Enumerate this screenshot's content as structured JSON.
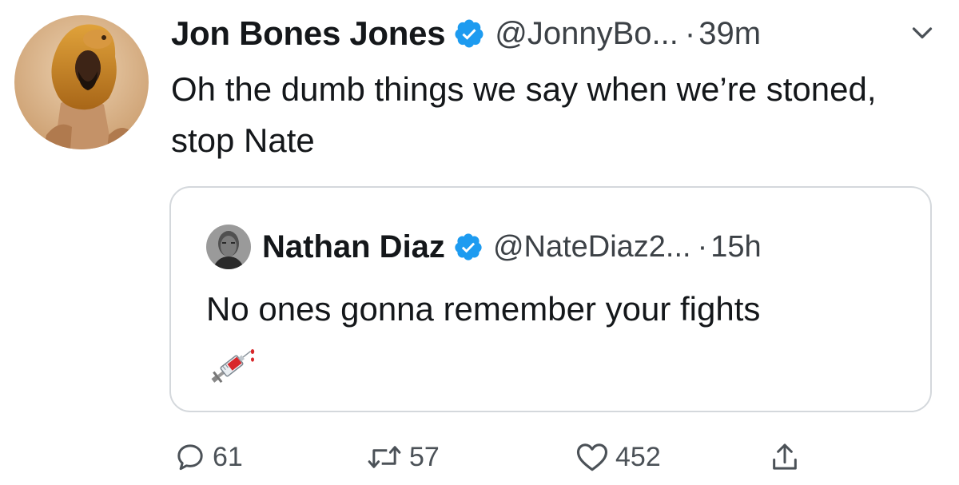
{
  "tweet": {
    "author": {
      "display_name": "Jon Bones Jones",
      "handle": "@JonnyBo...",
      "avatar_icon": "avatar-lion-headdress",
      "verified_icon": "verified-badge-icon"
    },
    "separator": "·",
    "timestamp": "39m",
    "menu_icon": "chevron-down-icon",
    "text": "Oh the dumb things we say when we’re stoned, stop Nate"
  },
  "quoted_tweet": {
    "author": {
      "display_name": "Nathan Diaz",
      "handle": "@NateDiaz2...",
      "avatar_icon": "avatar-portrait",
      "verified_icon": "verified-badge-icon"
    },
    "separator": "·",
    "timestamp": "15h",
    "text": "No ones gonna remember your fights",
    "emoji_icon": "syringe-emoji-icon"
  },
  "actions": {
    "reply_count": "61",
    "retweet_count": "57",
    "like_count": "452",
    "reply_icon": "reply-icon",
    "retweet_icon": "retweet-icon",
    "like_icon": "heart-icon",
    "share_icon": "share-icon"
  },
  "colors": {
    "verified_blue": "#1d9bf0",
    "text_primary": "#14171a",
    "text_secondary": "#3c4146",
    "card_border": "#d4d8dc"
  }
}
